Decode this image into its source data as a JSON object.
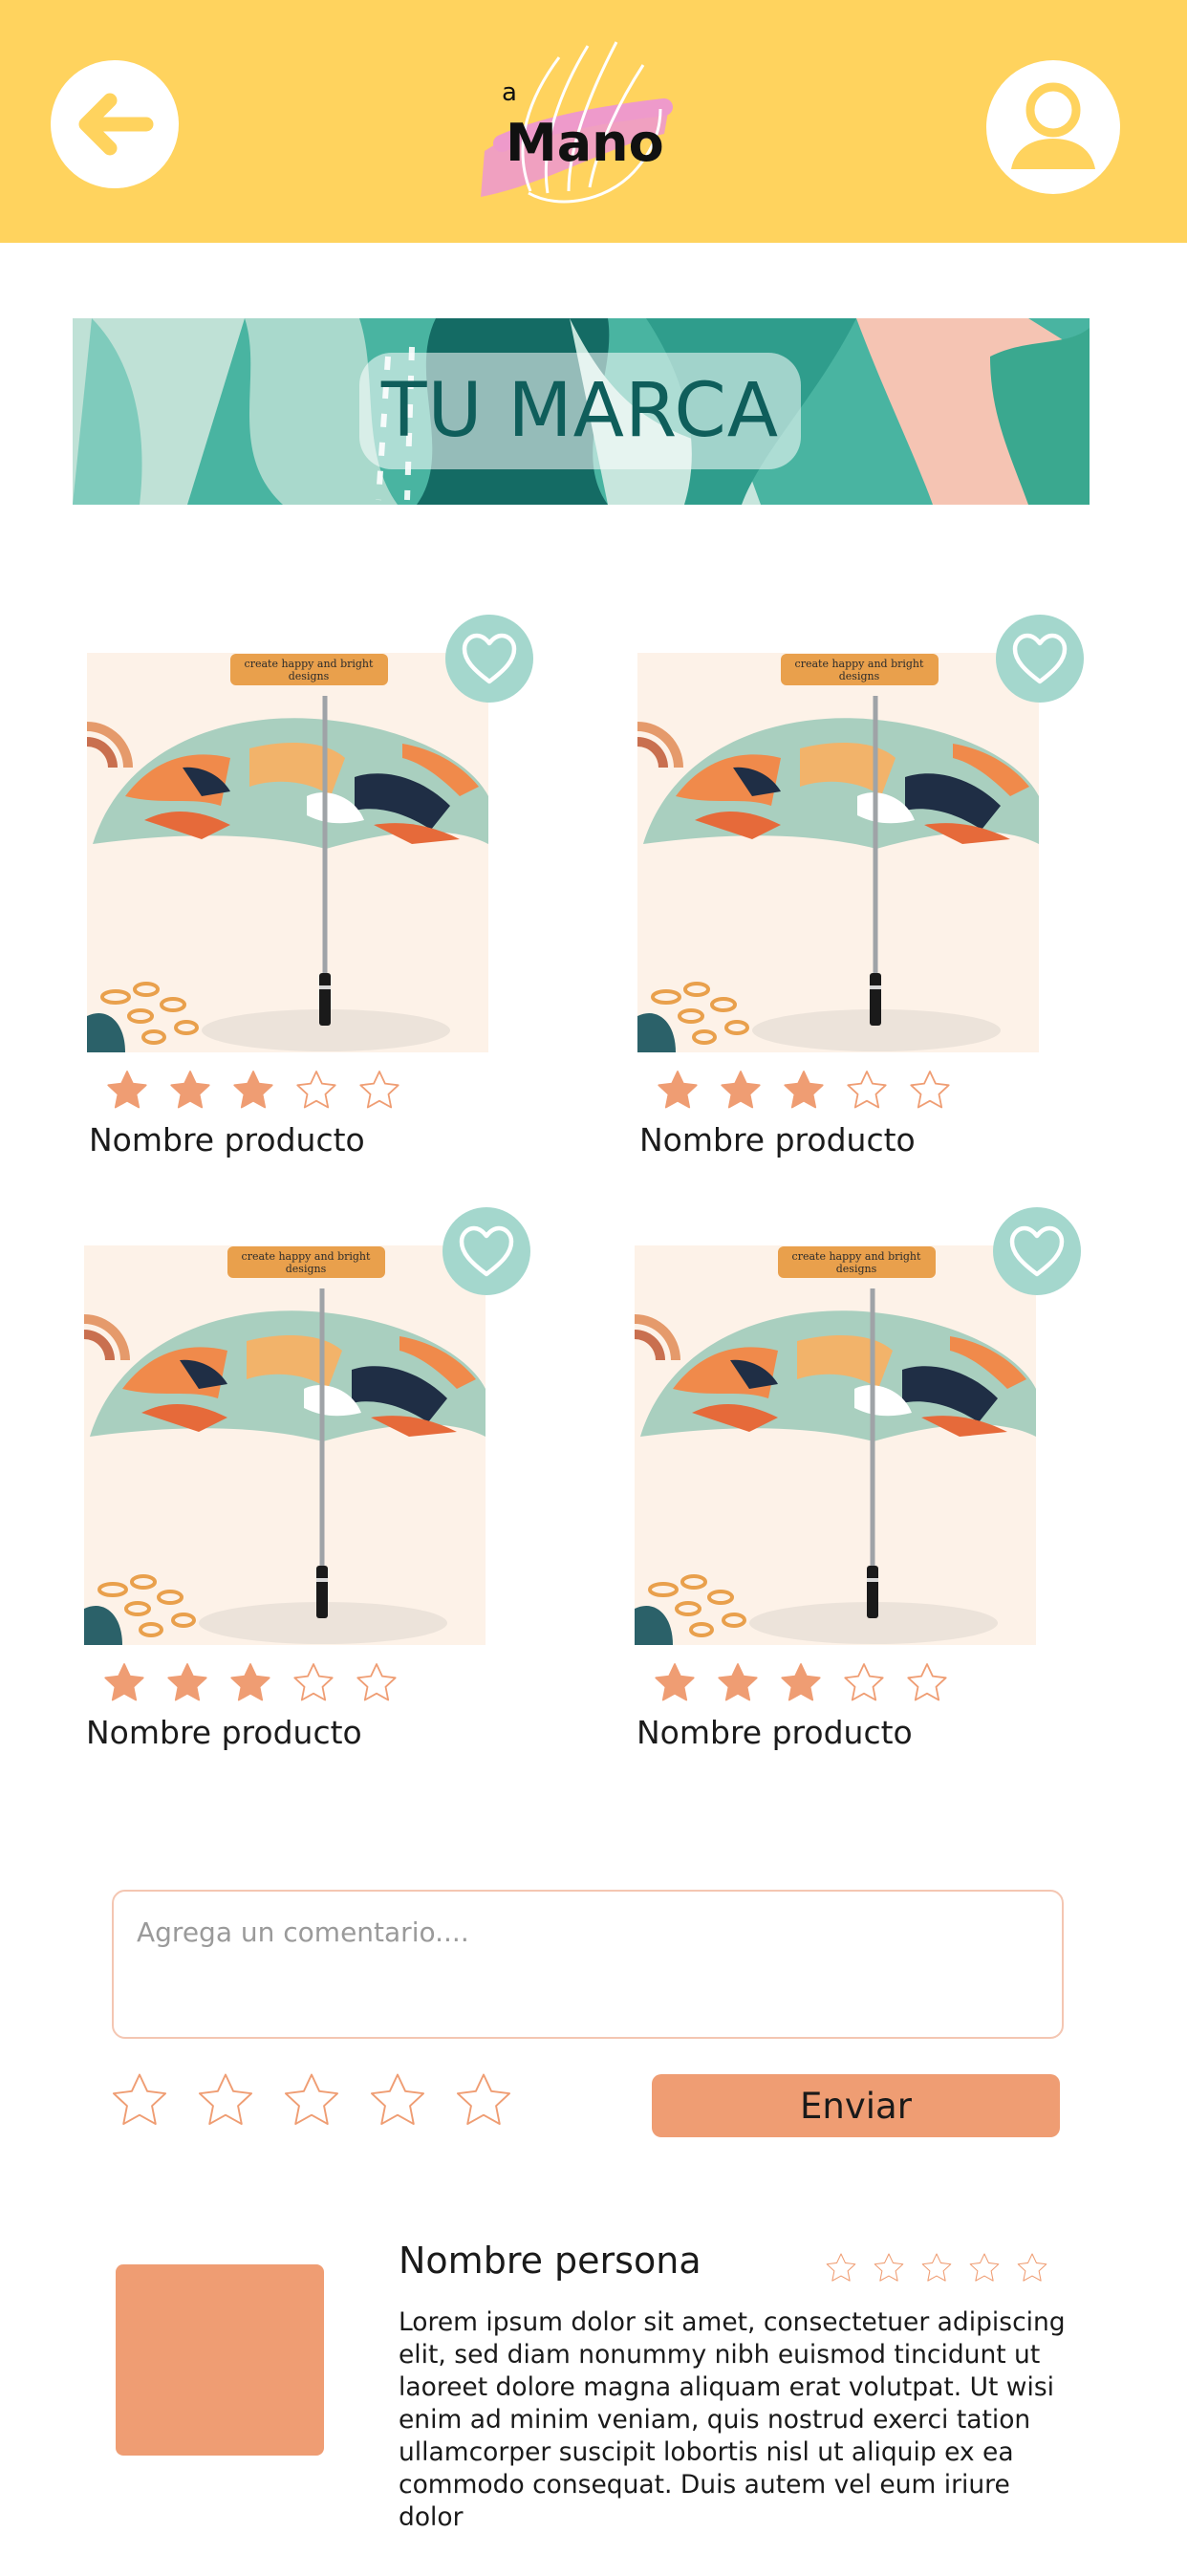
{
  "header": {
    "back_icon": "arrow-left-icon",
    "profile_icon": "user-icon",
    "logo": {
      "small_text": "a",
      "main_text": "Mano"
    },
    "colors": {
      "background": "#ffd35e",
      "icon": "#ffd35e"
    }
  },
  "banner": {
    "title": "TU MARCA"
  },
  "products": [
    {
      "name": "Nombre producto",
      "rating": 3,
      "max_rating": 5,
      "image_caption": "create happy and bright designs"
    },
    {
      "name": "Nombre producto",
      "rating": 3,
      "max_rating": 5,
      "image_caption": "create happy and bright designs"
    },
    {
      "name": "Nombre producto",
      "rating": 3,
      "max_rating": 5,
      "image_caption": "create happy and bright designs"
    },
    {
      "name": "Nombre producto",
      "rating": 3,
      "max_rating": 5,
      "image_caption": "create happy and bright designs"
    }
  ],
  "comment": {
    "placeholder": "Agrega un comentario....",
    "value": "",
    "rating": 0,
    "max_rating": 5,
    "submit_label": "Enviar"
  },
  "review": {
    "author": "Nombre persona",
    "rating": 0,
    "max_rating": 5,
    "text": "Lorem ipsum dolor sit amet, consectetuer adipiscing elit, sed diam nonummy nibh euismod tincidunt ut laoreet dolore magna aliquam erat volutpat. Ut wisi enim ad minim veniam, quis nostrud exerci tation ullamcorper suscipit lobortis nisl ut aliquip ex ea commodo consequat. Duis autem vel eum iriure dolor"
  },
  "colors": {
    "accent": "#ef9d73",
    "favorite": "#a4d7cd",
    "star_filled": "#ef9d73",
    "star_outline": "#ef9d73"
  }
}
